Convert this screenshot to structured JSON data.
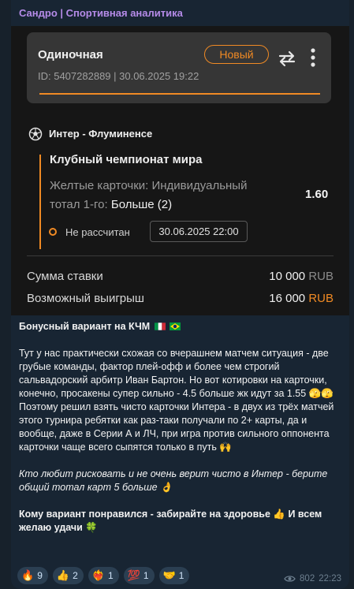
{
  "channel": {
    "title": "Сандро | Спортивная аналитика"
  },
  "bet": {
    "type": "Одиночная",
    "badge": "Новый",
    "id_line": "ID: 5407282889  |  30.06.2025 19:22",
    "match": "Интер - Флуминенсе",
    "tournament": "Клубный чемпионат мира",
    "market_prefix": "Желтые карточки: Индивидуальный тотал 1-го:",
    "selection": "Больше (2)",
    "odds": "1.60",
    "status": "Не рассчитан",
    "event_datetime": "30.06.2025 22:00",
    "stake_label": "Сумма ставки",
    "stake_value": "10 000",
    "stake_currency": "RUB",
    "win_label": "Возможный выигрыш",
    "win_value": "16 000",
    "win_currency": "RUB",
    "accent_color": "#f08a24"
  },
  "post": {
    "heading": "Бонусный вариант на КЧМ",
    "para1_a": "Тут у нас практически схожая со вчерашнем матчем ситуация - две грубые команды, фактор плей-офф и более чем строгий сальвадорский арбитр Иван Бартон. Но вот котировки на карточки, конечно, просакены супер сильно - 4.5 больше жк идут за 1.55",
    "para1_emoji_a": "🫣🫣",
    "para1_b": "Поэтому решил взять чисто карточки Интера - в двух из трёх матчей этого турнира ребятки как раз-таки получали по 2+ карты, да и вообще, даже в Серии А и ЛЧ, при игра против сильного оппонента карточки чаще всего сыпятся только в путь",
    "para1_emoji_b": "🙌",
    "para2": "Кто любит рисковать и не очень верит чисто в Интер - берите общий тотал карт 5 больше",
    "para2_emoji": "👌",
    "para3_a": "Кому вариант понравился - забирайте на здоровье",
    "para3_emoji_a": "👍",
    "para3_b": "И всем желаю удачи",
    "para3_emoji_b": "🍀"
  },
  "reactions": [
    {
      "emoji": "🔥",
      "count": "9"
    },
    {
      "emoji": "👍",
      "count": "2"
    },
    {
      "emoji": "❤️‍🔥",
      "count": "1"
    },
    {
      "emoji": "💯",
      "count": "1"
    },
    {
      "emoji": "🤝",
      "count": "1"
    }
  ],
  "meta": {
    "views": "802",
    "time": "22:23"
  }
}
